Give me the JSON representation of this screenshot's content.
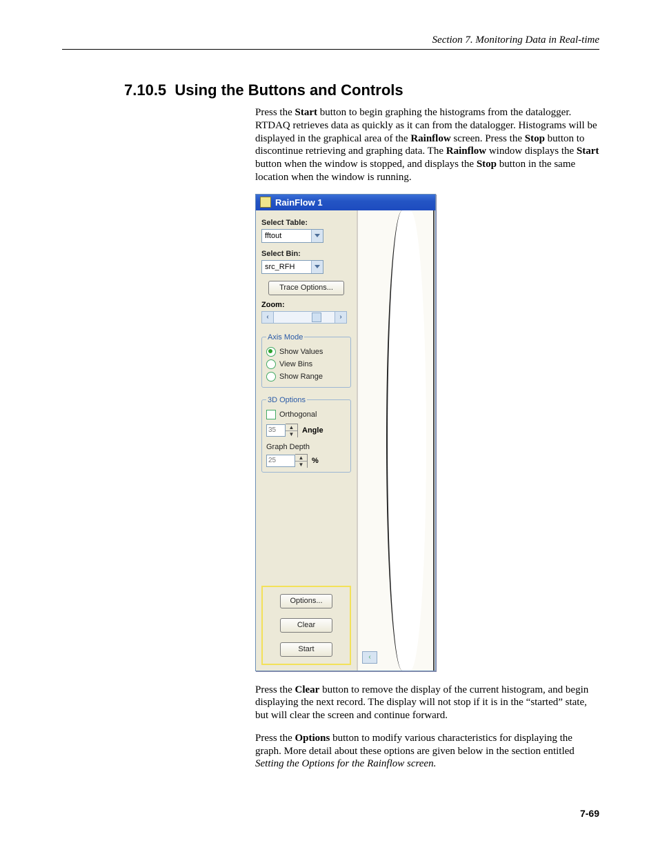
{
  "page": {
    "running_head": "Section 7.  Monitoring Data in Real-time",
    "section_number": "7.10.5",
    "section_title": "Using the Buttons and Controls",
    "page_number": "7-69"
  },
  "para1_parts": [
    "Press the ",
    "Start",
    " button to begin graphing the histograms from the datalogger. RTDAQ retrieves data as quickly as it can from the datalogger.  Histograms will be displayed in the graphical area of the ",
    "Rainflow",
    " screen.  Press the ",
    "Stop",
    " button to discontinue retrieving and graphing data.  The ",
    "Rainflow",
    " window displays the ",
    "Start",
    " button when the window is stopped, and displays the ",
    "Stop",
    " button in the same location when the window is running."
  ],
  "para2_parts": [
    "Press the ",
    "Clear",
    " button to remove the display of the current histogram, and begin displaying the next record.  The display will not stop if it is in the “started” state, but will clear the screen and continue forward."
  ],
  "para3_parts": [
    "Press the ",
    "Options",
    " button to modify various characteristics for displaying the graph.  More detail about these options are given below in the section entitled "
  ],
  "para3_italic": "Setting the Options for the Rainflow screen.",
  "ui": {
    "window_title": "RainFlow 1",
    "select_table_label": "Select Table:",
    "select_table_value": "fftout",
    "select_bin_label": "Select Bin:",
    "select_bin_value": "src_RFH",
    "trace_button": "Trace Options...",
    "zoom_label": "Zoom:",
    "axis_mode": {
      "legend": "Axis Mode",
      "options": [
        {
          "label": "Show Values",
          "checked": true
        },
        {
          "label": "View Bins",
          "checked": false
        },
        {
          "label": "Show Range",
          "checked": false
        }
      ]
    },
    "three_d": {
      "legend": "3D Options",
      "orthogonal_label": "Orthogonal",
      "angle_value": "35",
      "angle_label": "Angle",
      "depth_label": "Graph Depth",
      "depth_value": "25",
      "depth_unit": "%"
    },
    "bottom_buttons": {
      "options": "Options...",
      "clear": "Clear",
      "start": "Start"
    }
  }
}
